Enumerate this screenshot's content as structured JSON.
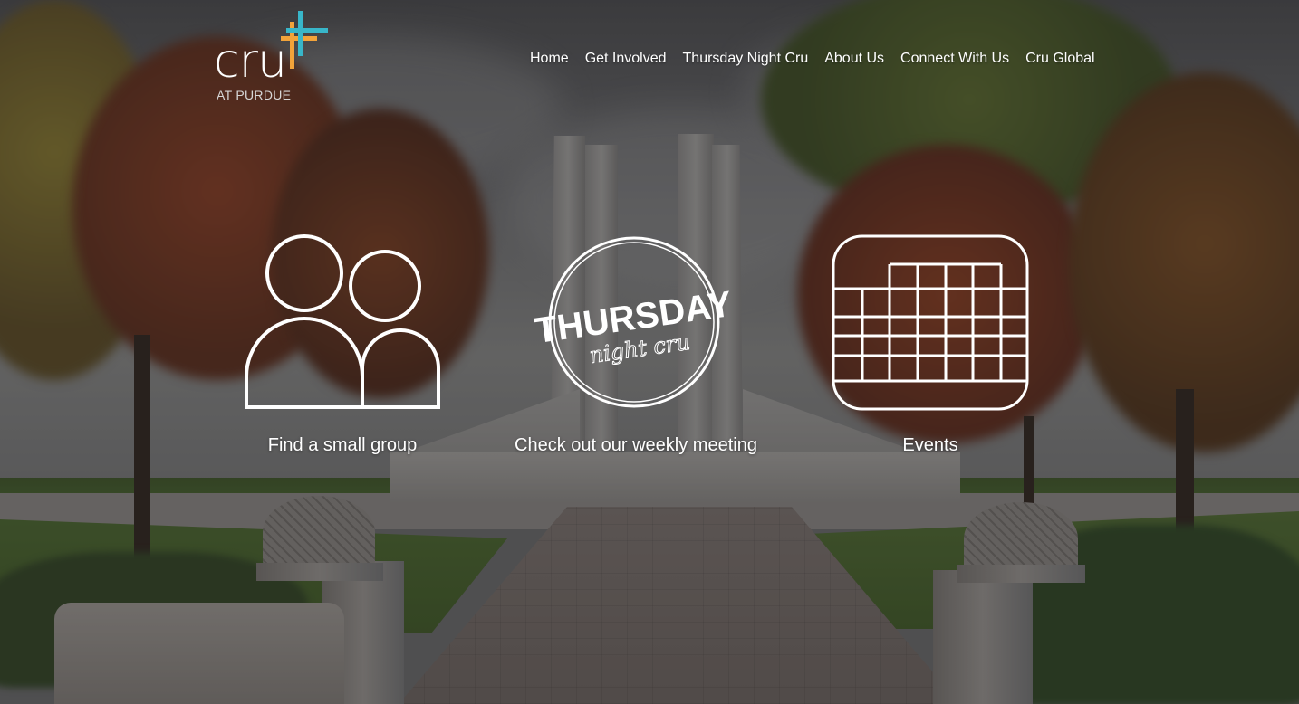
{
  "brand": {
    "logo_word": "cru",
    "logo_subtitle": "AT PURDUE",
    "cross_colors": [
      "#f2a33a",
      "#38b6c9"
    ]
  },
  "nav": {
    "items": [
      {
        "label": "Home"
      },
      {
        "label": "Get Involved"
      },
      {
        "label": "Thursday Night Cru"
      },
      {
        "label": "About Us"
      },
      {
        "label": "Connect With Us"
      },
      {
        "label": "Cru Global"
      }
    ]
  },
  "features": [
    {
      "icon": "people-icon",
      "label": "Find a small group"
    },
    {
      "icon": "thursday-night-cru-badge",
      "label": "Check out our weekly meeting",
      "badge_title": "THURSDAY",
      "badge_script": "night cru"
    },
    {
      "icon": "calendar-icon",
      "label": "Events"
    }
  ]
}
